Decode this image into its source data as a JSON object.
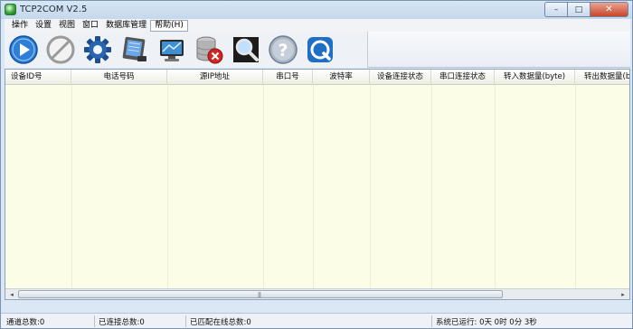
{
  "window": {
    "title": "TCP2COM V2.5"
  },
  "window_buttons": {
    "minimize": "–",
    "maximize": "□",
    "close": "✕"
  },
  "menu": [
    {
      "label": "操作"
    },
    {
      "label": "设置"
    },
    {
      "label": "视图"
    },
    {
      "label": "窗口"
    },
    {
      "label": "数据库管理"
    },
    {
      "label": "帮助(H)"
    }
  ],
  "toolbar": [
    {
      "icon": "play-icon"
    },
    {
      "icon": "stop-icon"
    },
    {
      "icon": "gear-icon"
    },
    {
      "icon": "tablet-icon"
    },
    {
      "icon": "monitor-icon"
    },
    {
      "icon": "database-delete-icon"
    },
    {
      "icon": "search-icon"
    },
    {
      "icon": "help-icon"
    },
    {
      "icon": "refresh-icon"
    }
  ],
  "table": {
    "columns": [
      {
        "label": "设备ID号"
      },
      {
        "label": "电话号码"
      },
      {
        "label": "源IP地址"
      },
      {
        "label": "串口号"
      },
      {
        "label": "波特率"
      },
      {
        "label": "设备连接状态"
      },
      {
        "label": "串口连接状态"
      },
      {
        "label": "转入数据量(byte)"
      },
      {
        "label": "转出数据量(byte)"
      }
    ],
    "rows": []
  },
  "scrollbar": {
    "grip": "|||",
    "left_arrow": "◂",
    "right_arrow": "▸"
  },
  "status": {
    "channels": "通道总数:0",
    "connected": "已连接总数:0",
    "matched_online": "已匹配在线总数:0",
    "uptime": "系统已运行: 0天  0时 0分 3秒"
  },
  "colors": {
    "grid_background": "#fbfde6",
    "title_gradient": "#c5d8ec",
    "close_button": "#c9452a"
  }
}
